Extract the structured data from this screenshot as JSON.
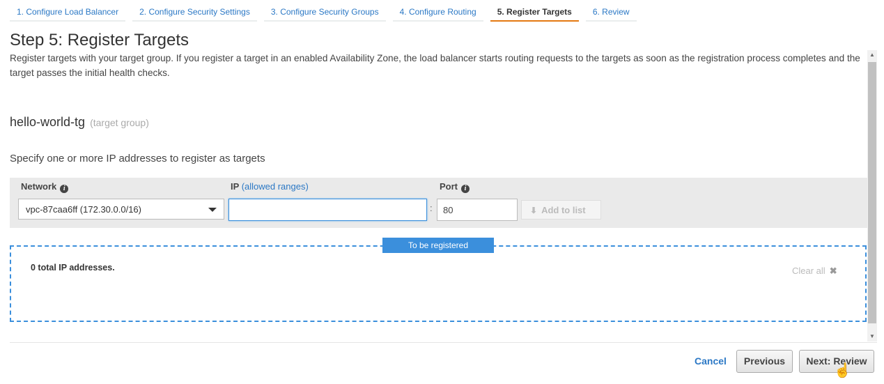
{
  "wizard": {
    "tabs": [
      {
        "label": "1. Configure Load Balancer"
      },
      {
        "label": "2. Configure Security Settings"
      },
      {
        "label": "3. Configure Security Groups"
      },
      {
        "label": "4. Configure Routing"
      },
      {
        "label": "5. Register Targets",
        "active": true
      },
      {
        "label": "6. Review"
      }
    ]
  },
  "page": {
    "title": "Step 5: Register Targets",
    "description": "Register targets with your target group. If you register a target in an enabled Availability Zone, the load balancer starts routing requests to the targets as soon as the registration process completes and the target passes the initial health checks."
  },
  "target_group": {
    "name": "hello-world-tg",
    "suffix": "(target group)"
  },
  "form": {
    "instruction": "Specify one or more IP addresses to register as targets",
    "network_label": "Network",
    "network_value": "vpc-87caa6ff (172.30.0.0/16)",
    "ip_label": "IP",
    "ip_link": "(allowed ranges)",
    "ip_value": "",
    "colon": ":",
    "port_label": "Port",
    "port_value": "80",
    "add_button": "Add to list",
    "info_glyph": "i",
    "add_icon": "⬇"
  },
  "registered": {
    "header": "To be registered",
    "total_text": "0 total IP addresses.",
    "clear_all": "Clear all",
    "clear_icon": "✖"
  },
  "footer": {
    "cancel": "Cancel",
    "previous": "Previous",
    "next": "Next: Review"
  },
  "colors": {
    "accent": "#2b78c5",
    "active_tab_border": "#e47911",
    "dashed_border": "#3b8fdc"
  }
}
